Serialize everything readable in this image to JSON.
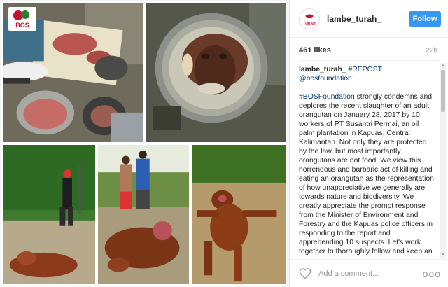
{
  "post": {
    "username": "lambe_turah_",
    "follow_label": "Follow",
    "likes": "461 likes",
    "time_ago": "22h",
    "caption_user": "lambe_turah_",
    "caption_repost": "#REPOST",
    "caption_mention": "@bosfoundation",
    "caption_hashtag": "#BOSFoundation",
    "caption_text": "strongly condemns and deplores the recent slaughter of an adult orangutan on January 28, 2017 by 10 workers of PT Susantri Permai, an oil palm plantation in Kapuas, Central Kalimantan. Not only they are protected by the law, but most importantly orangutans are not food. We view this horrendous and barbaric act of killing and eating an orangutan as the representation of how unappreciative we generally are towards nature and biodiversity. We greatly appreciate the prompt response from the Minister of Environment and Forestry and the Kapuas police officers in responding to the report and apprehending 10 suspects. Let's work together to thoroughly follow and keep an eye on",
    "comment_placeholder": "Add a comment...",
    "more_label": "ooo",
    "logo_text": "BOS"
  },
  "icons": [
    "heart-icon",
    "more-options-icon",
    "scroll-up-icon",
    "scroll-down-icon"
  ],
  "colors": {
    "follow": "#3897f0",
    "link": "#003569",
    "logo_red": "#c8102e"
  }
}
